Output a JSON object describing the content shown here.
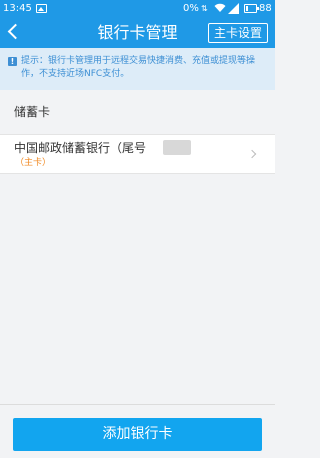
{
  "status_bar": {
    "time": "13:45",
    "battery_percent_text": "0%",
    "battery_level": "88",
    "icons": [
      "photo-icon",
      "data-arrows-icon",
      "wifi-icon",
      "signal-icon",
      "battery-icon"
    ]
  },
  "header": {
    "title": "银行卡管理",
    "main_card_button": "主卡设置"
  },
  "tip": {
    "icon": "exclamation-icon",
    "text": "提示：银行卡管理用于远程交易快捷消费、充值或提现等操作，不支持近场NFC支付。"
  },
  "section": {
    "title": "储蓄卡"
  },
  "cards": [
    {
      "name": "中国邮政储蓄银行（尾号",
      "tag": "（主卡）"
    }
  ],
  "footer": {
    "add_button": "添加银行卡"
  },
  "colors": {
    "header_blue": "#1f99e6",
    "button_blue": "#12a5ef",
    "tip_bg": "#ddecf8",
    "tip_text": "#3d8fd4",
    "tag_orange": "#f08a24"
  }
}
